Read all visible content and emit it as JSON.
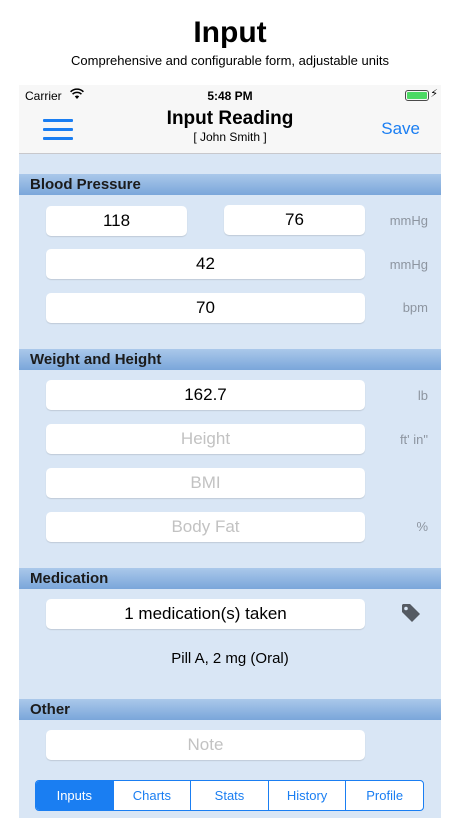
{
  "promo": {
    "title": "Input",
    "subtitle": "Comprehensive and configurable form, adjustable units"
  },
  "status_bar": {
    "carrier": "Carrier",
    "time": "5:48 PM",
    "battery_level": 1.0
  },
  "nav": {
    "title": "Input Reading",
    "subtitle": "[ John Smith ]",
    "save_label": "Save",
    "menu_icon": "hamburger-menu-icon"
  },
  "sections": {
    "blood_pressure": {
      "title": "Blood Pressure",
      "systolic": "118",
      "diastolic": "76",
      "bp_unit": "mmHg",
      "third_value": "42",
      "third_unit": "mmHg",
      "pulse": "70",
      "pulse_unit": "bpm"
    },
    "weight_height": {
      "title": "Weight and Height",
      "weight": "162.7",
      "weight_unit": "lb",
      "height_placeholder": "Height",
      "height_unit": "ft' in\"",
      "bmi_placeholder": "BMI",
      "body_fat_placeholder": "Body Fat",
      "body_fat_unit": "%"
    },
    "medication": {
      "title": "Medication",
      "summary": "1 medication(s) taken",
      "details": "Pill A, 2 mg (Oral)",
      "tag_icon": "tag-icon"
    },
    "other": {
      "title": "Other",
      "note_placeholder": "Note"
    }
  },
  "tabs": [
    {
      "label": "Inputs",
      "active": true
    },
    {
      "label": "Charts",
      "active": false
    },
    {
      "label": "Stats",
      "active": false
    },
    {
      "label": "History",
      "active": false
    },
    {
      "label": "Profile",
      "active": false
    }
  ],
  "colors": {
    "accent": "#1a7ef2",
    "background": "#d9e6f5",
    "section_header": "#7aa6da"
  }
}
